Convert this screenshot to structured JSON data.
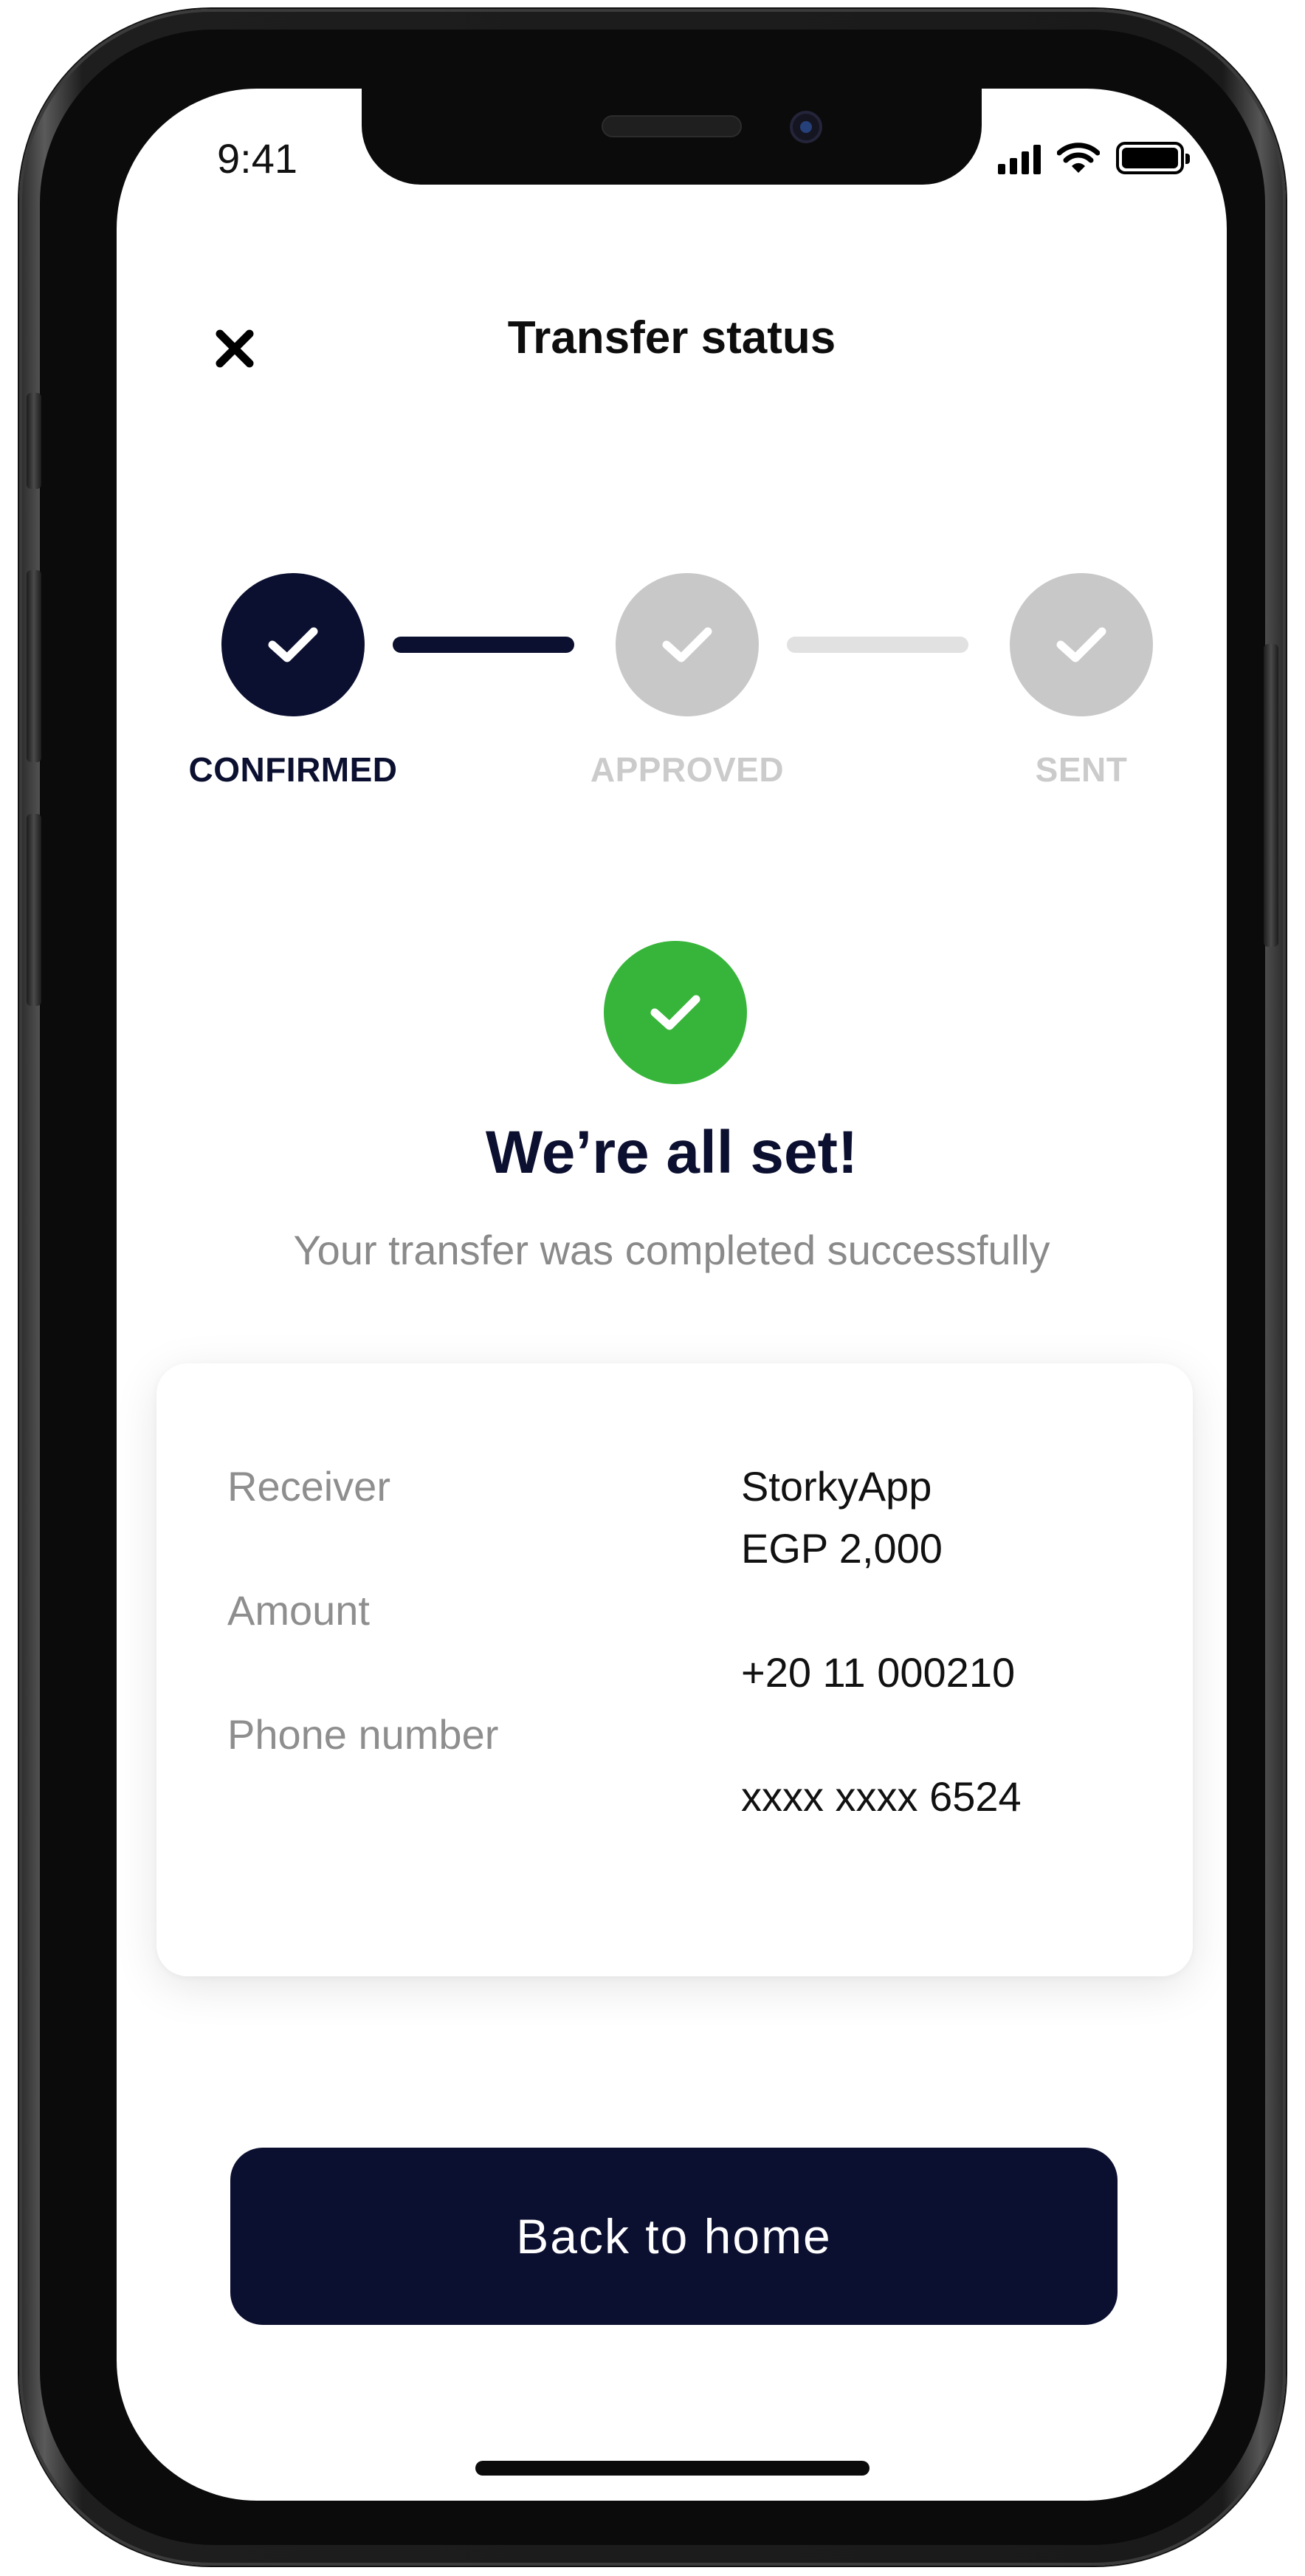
{
  "status_bar": {
    "time": "9:41",
    "icons": [
      "signal-icon",
      "wifi-icon",
      "battery-icon"
    ]
  },
  "header": {
    "close_icon": "close-icon",
    "title": "Transfer status"
  },
  "stepper": {
    "steps": [
      {
        "label": "CONFIRMED",
        "state": "done",
        "icon": "check-icon"
      },
      {
        "label": "APPROVED",
        "state": "pending",
        "icon": "check-icon"
      },
      {
        "label": "SENT",
        "state": "pending",
        "icon": "check-icon"
      }
    ],
    "colors": {
      "done": "#0c1030",
      "pending": "#c8c8c8"
    }
  },
  "success": {
    "icon": "check-icon",
    "title": "We’re all set!",
    "subtitle": "Your transfer was completed successfully",
    "color": "#37b53a"
  },
  "details": {
    "labels": [
      "Receiver",
      "Amount",
      "Phone number"
    ],
    "values": [
      "StorkyApp",
      "EGP 2,000",
      "+20 11 000210",
      "xxxx xxxx 6524"
    ]
  },
  "actions": {
    "home_button_label": "Back to home",
    "accent": "#0c1030"
  }
}
